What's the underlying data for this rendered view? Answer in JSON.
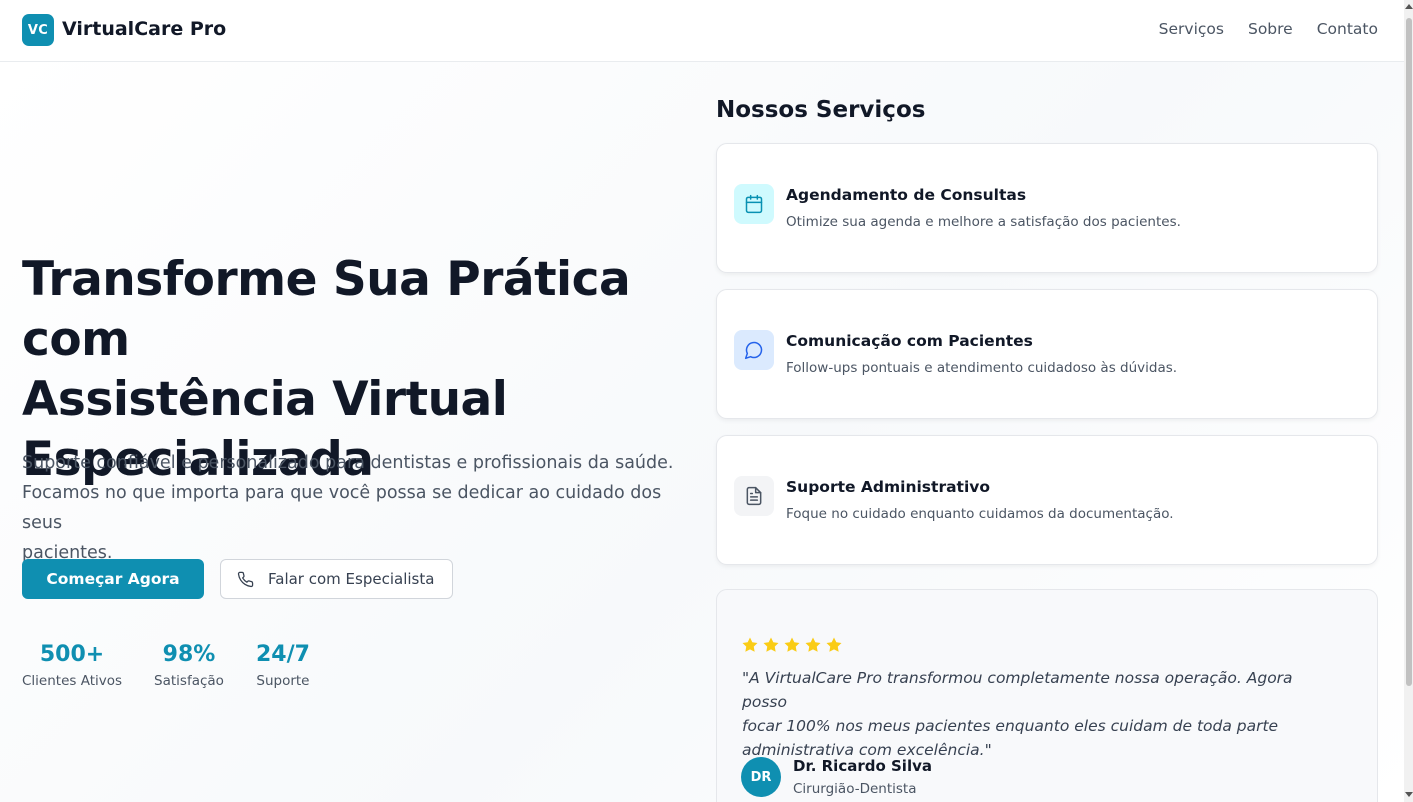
{
  "app": {
    "logo_badge": "VC",
    "name": "VirtualCare Pro",
    "accent_color": "#0f8fb1"
  },
  "nav": {
    "items": [
      {
        "label": "Serviços"
      },
      {
        "label": "Sobre"
      },
      {
        "label": "Contato"
      }
    ]
  },
  "hero": {
    "title_lines": [
      "Transforme Sua Prática com",
      "Assistência Virtual",
      "Especializada"
    ],
    "subtitle_lines": [
      "Suporte confiável e personalizado para dentistas e profissionais da saúde.",
      "Focamos no que importa para que você possa se dedicar ao cuidado dos seus",
      "pacientes."
    ],
    "primary_button": "Começar Agora",
    "secondary_button": "Falar com Especialista",
    "secondary_button_icon": "phone-icon",
    "stats": [
      {
        "value": "500+",
        "label": "Clientes Ativos"
      },
      {
        "value": "98%",
        "label": "Satisfação"
      },
      {
        "value": "24/7",
        "label": "Suporte"
      }
    ]
  },
  "services": {
    "heading": "Nossos Serviços",
    "items": [
      {
        "icon": "calendar-icon",
        "icon_bg": "#cffafe",
        "icon_color": "#0891b2",
        "title": "Agendamento de Consultas",
        "description": "Otimize sua agenda e melhore a satisfação dos pacientes."
      },
      {
        "icon": "chat-bubble-icon",
        "icon_bg": "#dbeafe",
        "icon_color": "#2563eb",
        "title": "Comunicação com Pacientes",
        "description": "Follow-ups pontuais e atendimento cuidadoso às dúvidas."
      },
      {
        "icon": "document-icon",
        "icon_bg": "#f3f4f6",
        "icon_color": "#4b5563",
        "title": "Suporte Administrativo",
        "description": "Foque no cuidado enquanto cuidamos da documentação."
      }
    ]
  },
  "testimonial": {
    "rating": 5,
    "star_color": "#facc15",
    "quote_lines": [
      "\"A VirtualCare Pro transformou completamente nossa operação. Agora posso",
      "focar 100% nos meus pacientes enquanto eles cuidam de toda parte",
      "administrativa com excelência.\""
    ],
    "avatar_initials": "DR",
    "author_name": "Dr. Ricardo Silva",
    "author_role": "Cirurgião-Dentista"
  }
}
